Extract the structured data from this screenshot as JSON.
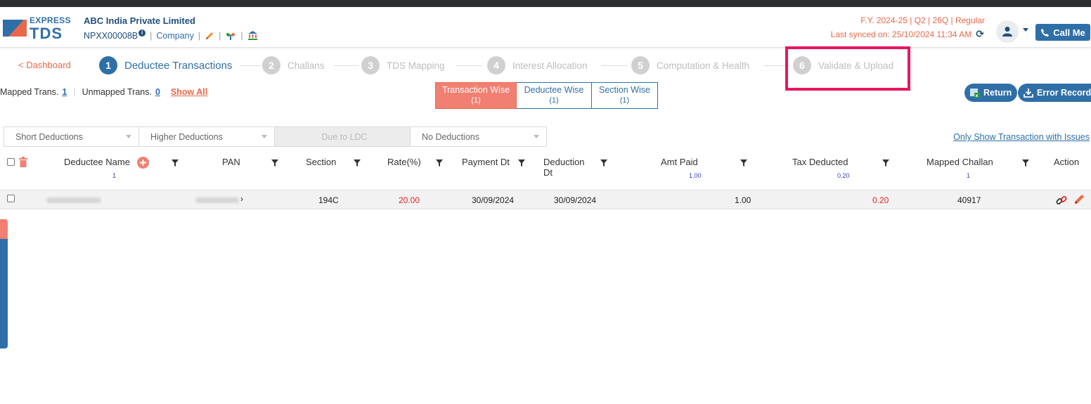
{
  "header": {
    "logo_express": "EXPRESS",
    "logo_tds": "TDS",
    "company_name": "ABC India Private Limited",
    "tan": "NPXX00008B",
    "info_badge": "i",
    "company_link": "Company",
    "fy_line": "F.Y. 2024-25  | Q2  | 26Q | Regular",
    "sync_line": "Last synced on: 25/10/2024 11:34 AM",
    "call_me": "Call Me"
  },
  "steps": {
    "dashboard_link": "< Dashboard",
    "items": [
      {
        "num": "1",
        "label": "Deductee Transactions",
        "active": true
      },
      {
        "num": "2",
        "label": "Challans",
        "active": false
      },
      {
        "num": "3",
        "label": "TDS Mapping",
        "active": false
      },
      {
        "num": "4",
        "label": "Interest Allocation",
        "active": false
      },
      {
        "num": "5",
        "label": "Computation & Health",
        "active": false
      },
      {
        "num": "6",
        "label": "Validate & Upload",
        "active": false
      }
    ]
  },
  "summary": {
    "mapped_label": "Mapped Trans.",
    "mapped_count": "1",
    "unmapped_label": "Unmapped Trans.",
    "unmapped_count": "0",
    "show_all": "Show All"
  },
  "view_toggle": [
    {
      "label": "Transaction Wise",
      "count": "(1)",
      "selected": true
    },
    {
      "label": "Deductee Wise",
      "count": "(1)",
      "selected": false
    },
    {
      "label": "Section Wise",
      "count": "(1)",
      "selected": false
    }
  ],
  "actions": {
    "return_label": "Return",
    "error_records_label": "Error Records"
  },
  "filters": [
    {
      "label": "Short Deductions",
      "disabled": false
    },
    {
      "label": "Higher Deductions",
      "disabled": false
    },
    {
      "label": "Due to LDC",
      "disabled": true
    },
    {
      "label": "No Deductions",
      "disabled": false
    }
  ],
  "only_show_issues": "Only Show Transaction with Issues",
  "table": {
    "headers": {
      "deductee_name": "Deductee Name",
      "deductee_count": "1",
      "pan": "PAN",
      "section": "Section",
      "rate": "Rate(%)",
      "payment_dt": "Payment Dt",
      "deduction_dt": "Deduction",
      "deduction_dt_2": "Dt",
      "amt_paid": "Amt Paid",
      "amt_paid_total": "1.00",
      "tax_deducted": "Tax Deducted",
      "tax_deducted_total": "0.20",
      "mapped_challan": "Mapped Challan",
      "mapped_challan_count": "1",
      "action": "Action"
    },
    "rows": [
      {
        "pan_suffix": "›",
        "section": "194C",
        "rate": "20.00",
        "payment_dt": "30/09/2024",
        "deduction_dt": "30/09/2024",
        "amt_paid": "1.00",
        "tax_deducted": "0.20",
        "mapped_challan": "40917"
      }
    ]
  },
  "colors": {
    "primary": "#2f6fa8",
    "accent": "#e8684a",
    "highlight_box": "#e8175d",
    "danger": "#e0281f"
  },
  "icons": [
    "pencil-icon",
    "ribbon-icon",
    "bank-icon",
    "refresh-icon",
    "user-icon",
    "phone-icon",
    "trash-icon",
    "add-icon",
    "filter-icon",
    "link-icon",
    "edit-icon",
    "excel-icon",
    "download-icon"
  ]
}
